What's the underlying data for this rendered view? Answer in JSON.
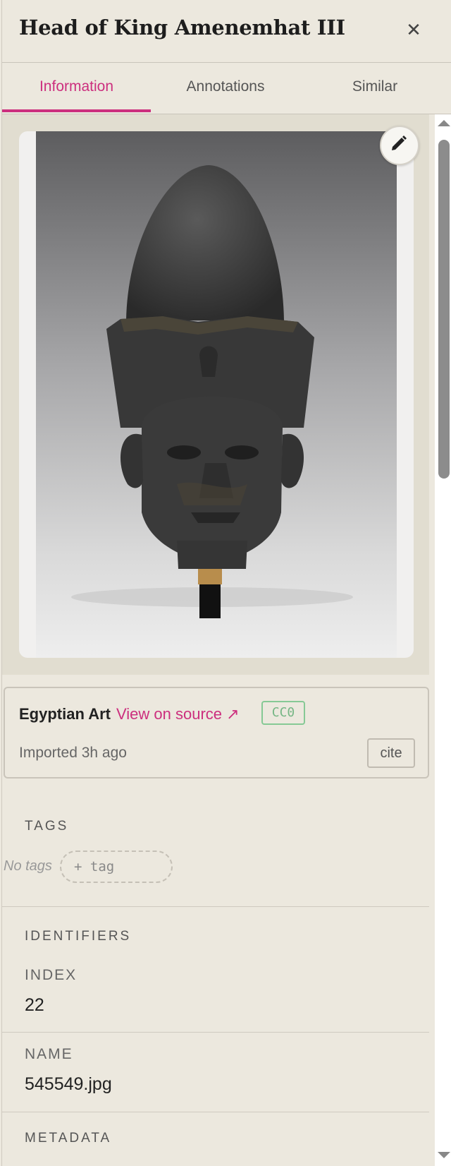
{
  "header": {
    "title": "Head of King Amenemhat III",
    "close_icon": "close-icon"
  },
  "tabs": [
    {
      "label": "Information",
      "active": true
    },
    {
      "label": "Annotations",
      "active": false
    },
    {
      "label": "Similar",
      "active": false
    }
  ],
  "image": {
    "edit_icon": "pencil-icon"
  },
  "source": {
    "collection": "Egyptian Art",
    "link_label": "View on source ↗",
    "license": "CC0",
    "imported": "Imported 3h ago",
    "cite_label": "cite"
  },
  "tags": {
    "heading": "TAGS",
    "empty_text": "No tags",
    "add_label": "+ tag"
  },
  "identifiers": {
    "heading": "IDENTIFIERS",
    "fields": [
      {
        "label": "INDEX",
        "value": "22"
      },
      {
        "label": "NAME",
        "value": "545549.jpg"
      }
    ]
  },
  "metadata": {
    "heading": "METADATA"
  },
  "colors": {
    "accent": "#cc2f7e",
    "license": "#76b685",
    "background": "#ece8de"
  }
}
